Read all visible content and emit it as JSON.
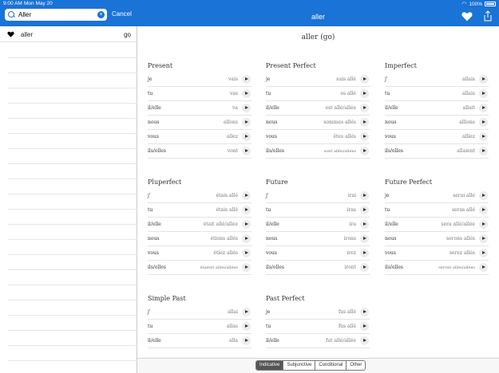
{
  "status_bar": {
    "time": "9:00 AM",
    "date": "Mon May 20",
    "battery": "100%"
  },
  "sidebar": {
    "search": {
      "value": "Aller",
      "placeholder": ""
    },
    "cancel_label": "Cancel",
    "results": [
      {
        "word": "aller",
        "translation": "go",
        "favorite": true
      }
    ]
  },
  "header": {
    "title": "aller"
  },
  "verb_title": "aller (go)",
  "tenses": [
    {
      "name": "Present",
      "rows": [
        {
          "pronoun": "je",
          "form": "vais"
        },
        {
          "pronoun": "tu",
          "form": "vas"
        },
        {
          "pronoun": "il/elle",
          "form": "va"
        },
        {
          "pronoun": "nous",
          "form": "allons"
        },
        {
          "pronoun": "vous",
          "form": "allez"
        },
        {
          "pronoun": "ils/elles",
          "form": "vont"
        }
      ]
    },
    {
      "name": "Present Perfect",
      "rows": [
        {
          "pronoun": "je",
          "form": "suis allé"
        },
        {
          "pronoun": "tu",
          "form": "es allé"
        },
        {
          "pronoun": "il/elle",
          "form": "est allé/allée"
        },
        {
          "pronoun": "nous",
          "form": "sommes allés"
        },
        {
          "pronoun": "vous",
          "form": "êtes allés"
        },
        {
          "pronoun": "ils/elles",
          "form": "sont allés/allées"
        }
      ]
    },
    {
      "name": "Imperfect",
      "rows": [
        {
          "pronoun": "j'",
          "form": "allais"
        },
        {
          "pronoun": "tu",
          "form": "allais"
        },
        {
          "pronoun": "il/elle",
          "form": "allait"
        },
        {
          "pronoun": "nous",
          "form": "allions"
        },
        {
          "pronoun": "vous",
          "form": "alliez"
        },
        {
          "pronoun": "ils/elles",
          "form": "allaient"
        }
      ]
    },
    {
      "name": "Pluperfect",
      "rows": [
        {
          "pronoun": "j'",
          "form": "étais allé"
        },
        {
          "pronoun": "tu",
          "form": "étais allé"
        },
        {
          "pronoun": "il/elle",
          "form": "était allé/allée"
        },
        {
          "pronoun": "nous",
          "form": "étions allés"
        },
        {
          "pronoun": "vous",
          "form": "étiez allés"
        },
        {
          "pronoun": "ils/elles",
          "form": "étaient allés/allées"
        }
      ]
    },
    {
      "name": "Future",
      "rows": [
        {
          "pronoun": "j'",
          "form": "irai"
        },
        {
          "pronoun": "tu",
          "form": "iras"
        },
        {
          "pronoun": "il/elle",
          "form": "ira"
        },
        {
          "pronoun": "nous",
          "form": "irons"
        },
        {
          "pronoun": "vous",
          "form": "irez"
        },
        {
          "pronoun": "ils/elles",
          "form": "iront"
        }
      ]
    },
    {
      "name": "Future Perfect",
      "rows": [
        {
          "pronoun": "je",
          "form": "serai allé"
        },
        {
          "pronoun": "tu",
          "form": "seras allé"
        },
        {
          "pronoun": "il/elle",
          "form": "sera allé/allée"
        },
        {
          "pronoun": "nous",
          "form": "serons allés"
        },
        {
          "pronoun": "vous",
          "form": "serez allés"
        },
        {
          "pronoun": "ils/elles",
          "form": "seront allés/allées"
        }
      ]
    },
    {
      "name": "Simple Past",
      "rows": [
        {
          "pronoun": "j'",
          "form": "allai"
        },
        {
          "pronoun": "tu",
          "form": "allas"
        },
        {
          "pronoun": "il/elle",
          "form": "alla"
        },
        {
          "pronoun": "",
          "form": ""
        }
      ]
    },
    {
      "name": "Past Perfect",
      "rows": [
        {
          "pronoun": "je",
          "form": "fus allé"
        },
        {
          "pronoun": "tu",
          "form": "fus allé"
        },
        {
          "pronoun": "il/elle",
          "form": "fut allé/allée"
        },
        {
          "pronoun": "",
          "form": ""
        }
      ]
    }
  ],
  "segments": [
    {
      "label": "Indicative",
      "active": true
    },
    {
      "label": "Subjunctive",
      "active": false
    },
    {
      "label": "Conditional",
      "active": false
    },
    {
      "label": "Other",
      "active": false
    }
  ],
  "colors": {
    "accent": "#1a73d6",
    "segment_active": "#555555"
  }
}
